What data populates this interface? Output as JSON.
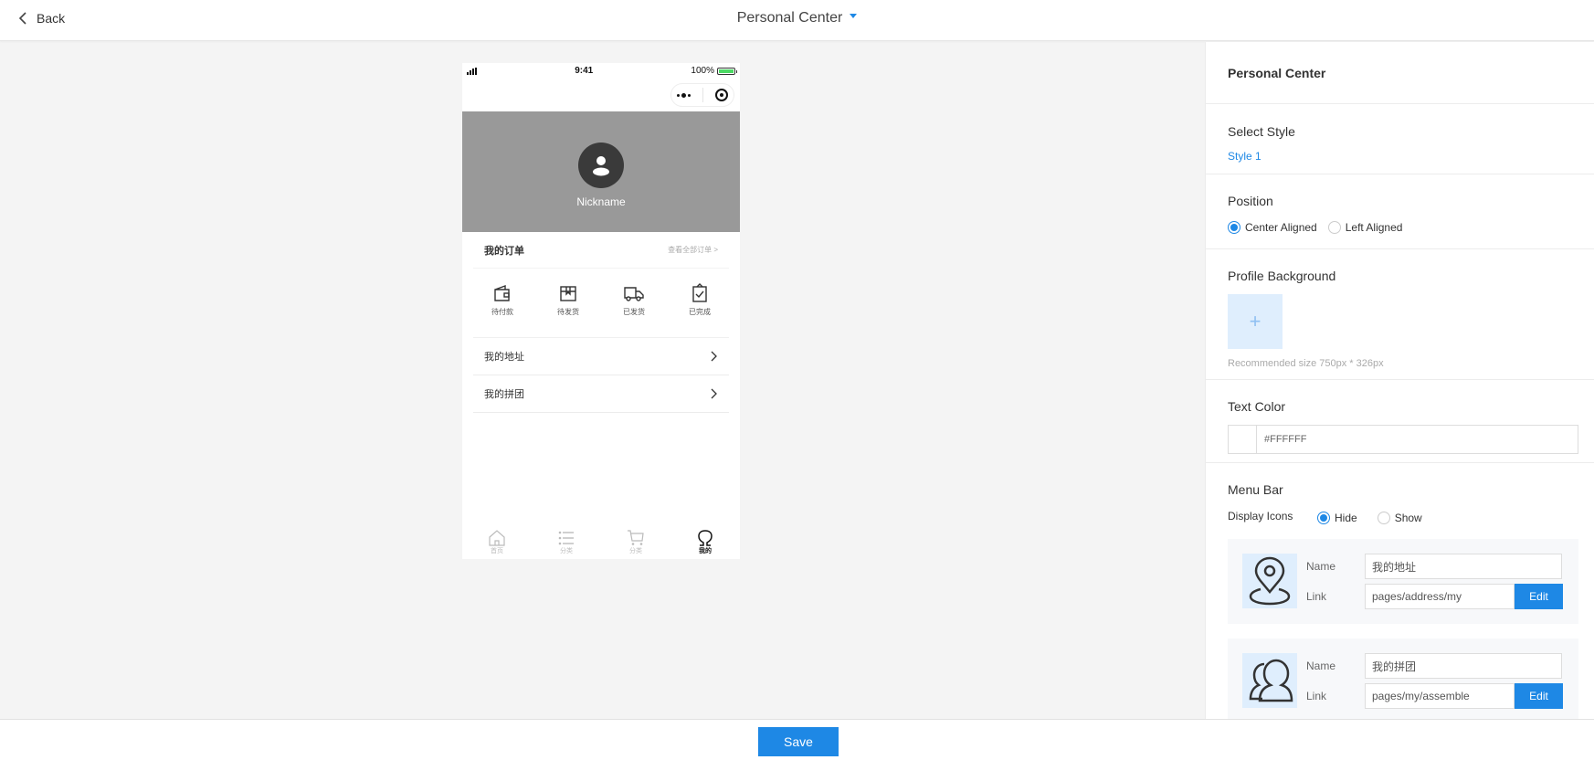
{
  "header": {
    "back_label": "Back",
    "title": "Personal Center"
  },
  "phone": {
    "status": {
      "time": "9:41",
      "battery": "100%"
    },
    "profile": {
      "nickname": "Nickname",
      "background_color": "#999999"
    },
    "orders": {
      "title": "我的订单",
      "view_all": "查看全部订单 >",
      "items": [
        {
          "label": "待付款",
          "icon": "wallet-icon"
        },
        {
          "label": "待发货",
          "icon": "package-icon"
        },
        {
          "label": "已发货",
          "icon": "truck-icon"
        },
        {
          "label": "已完成",
          "icon": "clipboard-check-icon"
        }
      ]
    },
    "menu": [
      {
        "label": "我的地址"
      },
      {
        "label": "我的拼团"
      }
    ],
    "tabbar": [
      {
        "label": "首页",
        "icon": "home-icon",
        "active": false
      },
      {
        "label": "分类",
        "icon": "list-icon",
        "active": false
      },
      {
        "label": "分类",
        "icon": "cart-icon",
        "active": false
      },
      {
        "label": "我的",
        "icon": "user-icon",
        "active": true
      }
    ]
  },
  "panel": {
    "title": "Personal Center",
    "select_style": {
      "label": "Select Style",
      "value": "Style 1"
    },
    "position": {
      "label": "Position",
      "options": [
        "Center Aligned",
        "Left Aligned"
      ],
      "selected": "Center Aligned"
    },
    "profile_background": {
      "label": "Profile Background",
      "upload_symbol": "+",
      "hint": "Recommended size 750px * 326px"
    },
    "text_color": {
      "label": "Text Color",
      "value": "#FFFFFF"
    },
    "menu_bar": {
      "label": "Menu Bar",
      "display_icons_label": "Display Icons",
      "display_options": [
        "Hide",
        "Show"
      ],
      "display_selected": "Hide",
      "name_label": "Name",
      "link_label": "Link",
      "edit_label": "Edit",
      "items": [
        {
          "icon": "location-pin-icon",
          "name": "我的地址",
          "link": "pages/address/my"
        },
        {
          "icon": "group-users-icon",
          "name": "我的拼团",
          "link": "pages/my/assemble"
        }
      ]
    }
  },
  "footer": {
    "save_label": "Save"
  },
  "colors": {
    "accent": "#1e88e5",
    "canvas": "#f4f4f4",
    "upload_bg": "#dfeefd"
  }
}
